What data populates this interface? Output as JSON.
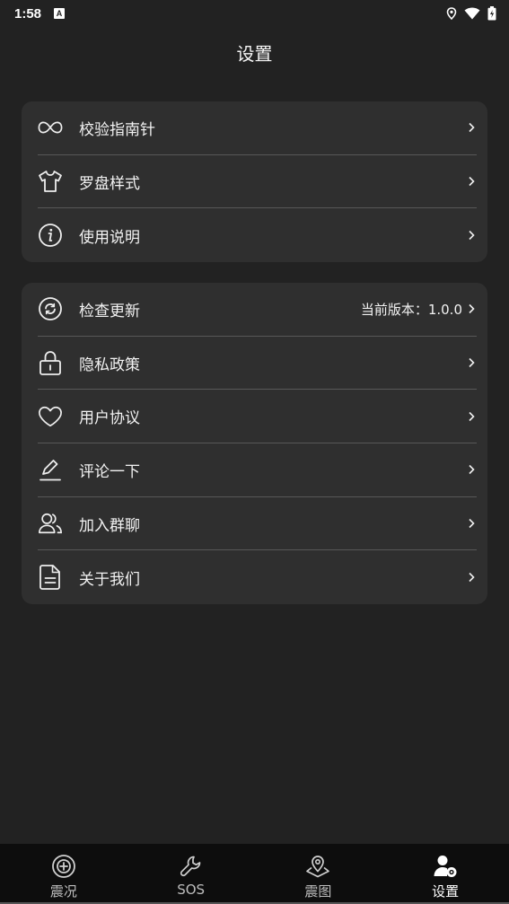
{
  "status_bar": {
    "time": "1:58",
    "notification_badge": "A",
    "icons": [
      "location-icon",
      "wifi-icon",
      "battery-icon"
    ]
  },
  "header": {
    "title": "设置"
  },
  "settings_group_1": [
    {
      "icon": "infinity-icon",
      "label": "校验指南针"
    },
    {
      "icon": "shirt-icon",
      "label": "罗盘样式"
    },
    {
      "icon": "info-icon",
      "label": "使用说明"
    }
  ],
  "settings_group_2": [
    {
      "icon": "refresh-icon",
      "label": "检查更新",
      "value": "当前版本：1.0.0"
    },
    {
      "icon": "lock-icon",
      "label": "隐私政策"
    },
    {
      "icon": "heart-icon",
      "label": "用户协议"
    },
    {
      "icon": "pencil-icon",
      "label": "评论一下"
    },
    {
      "icon": "users-icon",
      "label": "加入群聊"
    },
    {
      "icon": "document-icon",
      "label": "关于我们"
    }
  ],
  "tab_bar": {
    "tabs": [
      {
        "icon": "target-plus-icon",
        "label": "震况",
        "active": false
      },
      {
        "icon": "wrench-icon",
        "label": "SOS",
        "active": false
      },
      {
        "icon": "map-pin-icon",
        "label": "震图",
        "active": false
      },
      {
        "icon": "user-settings-icon",
        "label": "设置",
        "active": true
      }
    ]
  },
  "colors": {
    "background": "#222222",
    "card": "#2f2f2f",
    "divider": "#585858",
    "tab_bar": "#0d0d0d",
    "text": "#f2f2f2"
  }
}
